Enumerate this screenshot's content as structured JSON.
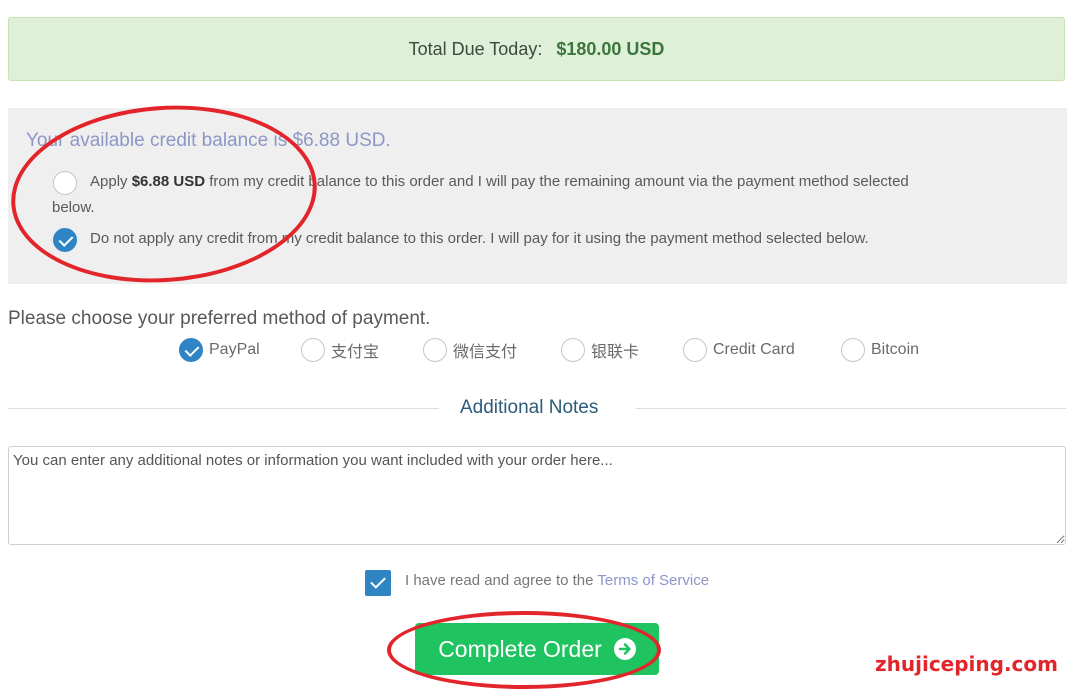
{
  "total_due": {
    "label": "Total Due Today:",
    "amount": "$180.00 USD"
  },
  "credit": {
    "heading": "Your available credit balance is $6.88 USD.",
    "apply_option": {
      "prefix": "Apply ",
      "amount": "$6.88 USD",
      "suffix": " from my credit balance to this order and I will pay the remaining amount via the payment method selected",
      "wrap": "below.",
      "selected": false
    },
    "no_apply_option": {
      "label": "Do not apply any credit from my credit balance to this order. I will pay for it using the payment method selected below.",
      "selected": true
    }
  },
  "payment": {
    "heading": "Please choose your preferred method of payment.",
    "methods": [
      {
        "label": "PayPal",
        "selected": true
      },
      {
        "label": "支付宝",
        "selected": false
      },
      {
        "label": "微信支付",
        "selected": false
      },
      {
        "label": "银联卡",
        "selected": false
      },
      {
        "label": "Credit Card",
        "selected": false
      },
      {
        "label": "Bitcoin",
        "selected": false
      }
    ]
  },
  "notes": {
    "title": "Additional Notes",
    "placeholder": "You can enter any additional notes or information you want included with your order here..."
  },
  "terms": {
    "checked": true,
    "text": "I have read and agree to the ",
    "link": "Terms of Service"
  },
  "complete_button": {
    "label": "Complete Order"
  },
  "watermark": "zhujiceping.com",
  "colors": {
    "accent_blue": "#2f85c4",
    "success_green": "#1fc35f",
    "annotation_red": "#e2252b"
  }
}
